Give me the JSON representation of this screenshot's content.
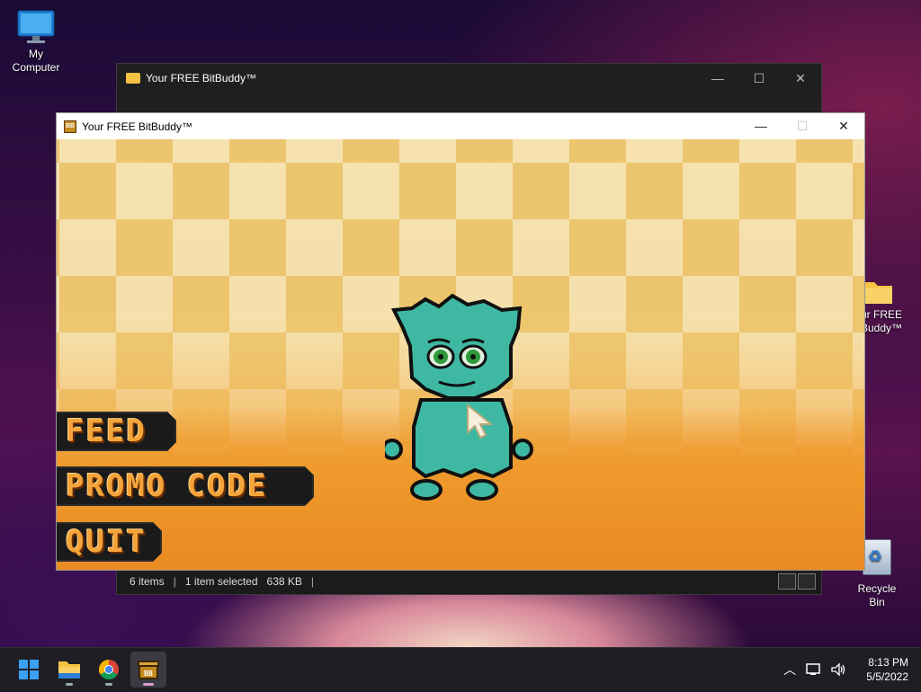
{
  "desktop": {
    "icons": [
      {
        "label": "My Computer"
      },
      {
        "label": "ur FREE\nBuddy™"
      },
      {
        "label": "Recycle Bin"
      }
    ]
  },
  "explorer": {
    "title": "Your FREE BitBuddy™",
    "status": {
      "items": "6 items",
      "selected": "1 item selected",
      "size": "638 KB"
    }
  },
  "game": {
    "title": "Your FREE BitBuddy™",
    "app_icon_text": "BB",
    "menu": {
      "feed": "FEED",
      "promo": "PROMO CODE",
      "quit": "QUIT"
    },
    "creature_color": "#3fb8a3"
  },
  "taskbar": {
    "apps": [
      "start",
      "file-explorer",
      "chrome",
      "bitbuddy"
    ],
    "time": "8:13 PM",
    "date": "5/5/2022"
  },
  "colors": {
    "menu_text": "#f5a43a",
    "taskbar_bg": "#1e1e24"
  }
}
